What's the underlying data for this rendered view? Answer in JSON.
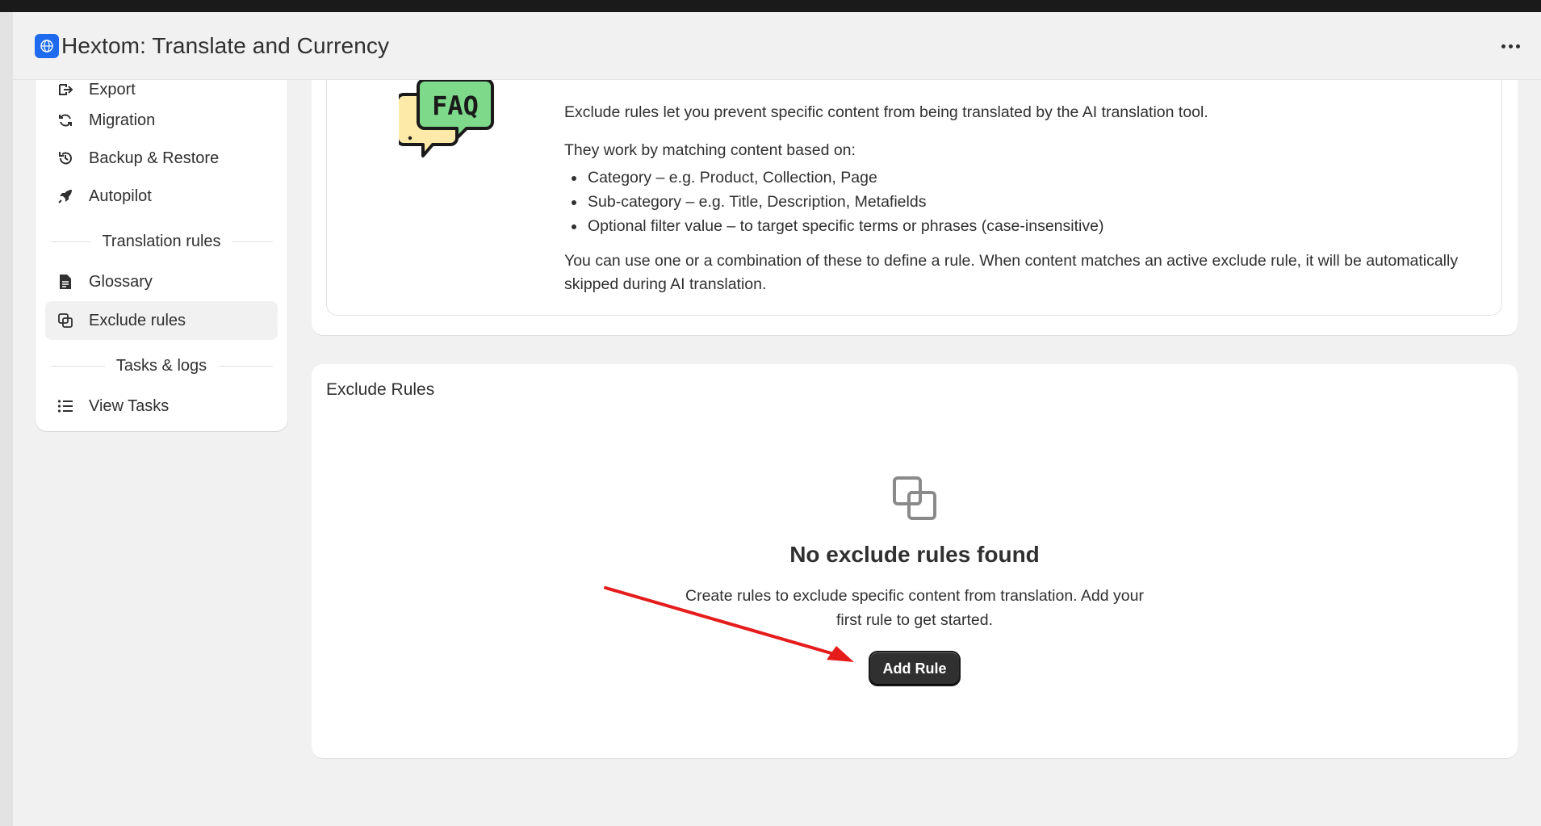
{
  "app": {
    "title": "Hextom: Translate and Currency",
    "icon": "globe-icon",
    "more_icon": "more-horizontal-icon"
  },
  "sidebar": {
    "items_top": [
      {
        "label": "Export",
        "icon": "export-icon"
      },
      {
        "label": "Migration",
        "icon": "refresh-icon"
      },
      {
        "label": "Backup & Restore",
        "icon": "history-icon"
      },
      {
        "label": "Autopilot",
        "icon": "rocket-icon"
      }
    ],
    "section_translation": "Translation rules",
    "items_translation": [
      {
        "label": "Glossary",
        "icon": "document-icon"
      },
      {
        "label": "Exclude rules",
        "icon": "exclude-icon",
        "active": true
      }
    ],
    "section_tasks": "Tasks & logs",
    "items_tasks": [
      {
        "label": "View Tasks",
        "icon": "list-icon"
      }
    ]
  },
  "info": {
    "intro": "Exclude rules let you prevent specific content from being translated by the AI translation tool.",
    "matching": "They work by matching content based on:",
    "bullets": [
      "Category – e.g. Product, Collection, Page",
      "Sub-category – e.g. Title, Description, Metafields",
      "Optional filter value – to target specific terms or phrases (case-insensitive)"
    ],
    "summary": "You can use one or a combination of these to define a rule. When content matches an active exclude rule, it will be automatically skipped during AI translation.",
    "faq_art_text": "FAQ"
  },
  "rules": {
    "title": "Exclude Rules",
    "empty_title": "No exclude rules found",
    "empty_desc": "Create rules to exclude specific content from translation. Add your first rule to get started.",
    "add_button": "Add Rule",
    "empty_icon": "exclude-icon"
  },
  "colors": {
    "accent_blue": "#1f6bf0",
    "primary_button": "#303030",
    "annotation_arrow": "#e61c1c",
    "faq_green": "#7ed98a",
    "faq_yellow": "#fde9a8"
  }
}
